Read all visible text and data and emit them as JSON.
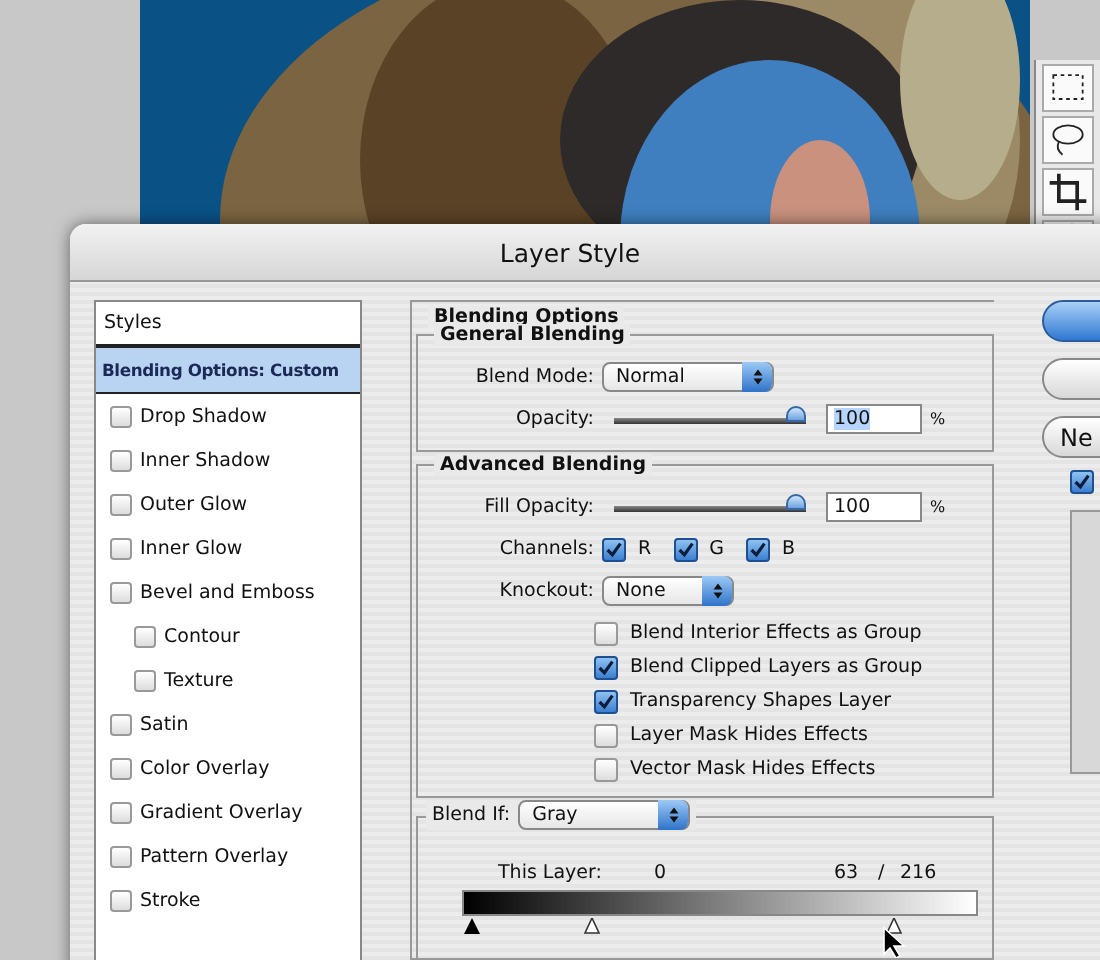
{
  "window": {
    "title": "Layer Style"
  },
  "styles_list": {
    "header": "Styles",
    "items": [
      {
        "label": "Blending Options: Custom",
        "kind": "heading",
        "selected": true
      },
      {
        "label": "Drop Shadow",
        "kind": "effect",
        "checked": false,
        "selected": false
      },
      {
        "label": "Inner Shadow",
        "kind": "effect",
        "checked": false,
        "selected": false
      },
      {
        "label": "Outer Glow",
        "kind": "effect",
        "checked": false,
        "selected": false
      },
      {
        "label": "Inner Glow",
        "kind": "effect",
        "checked": false,
        "selected": false
      },
      {
        "label": "Bevel and Emboss",
        "kind": "effect",
        "checked": false,
        "selected": false,
        "children": [
          {
            "label": "Contour",
            "kind": "effect",
            "checked": false,
            "selected": false
          },
          {
            "label": "Texture",
            "kind": "effect",
            "checked": false,
            "selected": false
          }
        ]
      },
      {
        "label": "Satin",
        "kind": "effect",
        "checked": false,
        "selected": false
      },
      {
        "label": "Color Overlay",
        "kind": "effect",
        "checked": false,
        "selected": false
      },
      {
        "label": "Gradient Overlay",
        "kind": "effect",
        "checked": false,
        "selected": false
      },
      {
        "label": "Pattern Overlay",
        "kind": "effect",
        "checked": false,
        "selected": false
      },
      {
        "label": "Stroke",
        "kind": "effect",
        "checked": false,
        "selected": false
      }
    ]
  },
  "blending_options": {
    "title": "Blending Options",
    "general": {
      "title": "General Blending",
      "blend_mode": {
        "label": "Blend Mode:",
        "value": "Normal"
      },
      "opacity": {
        "label": "Opacity:",
        "level": 1,
        "value": "100",
        "text_selected": true,
        "unit": "%"
      }
    },
    "advanced": {
      "title": "Advanced Blending",
      "fill_opacity": {
        "label": "Fill Opacity:",
        "level": 1,
        "value": "100",
        "text_selected": false,
        "unit": "%"
      },
      "channels": {
        "label": "Channels:",
        "items": [
          {
            "label": "R",
            "checked": true
          },
          {
            "label": "G",
            "checked": true
          },
          {
            "label": "B",
            "checked": true
          }
        ]
      },
      "knockout": {
        "label": "Knockout:",
        "value": "None"
      },
      "options": [
        {
          "label": "Blend Interior Effects as Group",
          "checked": false
        },
        {
          "label": "Blend Clipped Layers as Group",
          "checked": true
        },
        {
          "label": "Transparency Shapes Layer",
          "checked": true
        },
        {
          "label": "Layer Mask Hides Effects",
          "checked": false
        },
        {
          "label": "Vector Mask Hides Effects",
          "checked": false
        }
      ]
    },
    "blend_if": {
      "label": "Blend If:",
      "value": "Gray",
      "this_layer": {
        "label": "This Layer:",
        "low": "0",
        "high_a": "63",
        "separator": "/",
        "high_b": "216",
        "thumbs": [
          {
            "kind": "solid",
            "level": 0
          },
          {
            "kind": "half",
            "level": 0.24
          },
          {
            "kind": "half",
            "level": 0.85
          }
        ]
      }
    }
  },
  "buttons": [
    {
      "kind": "default"
    },
    {
      "kind": "plain"
    },
    {
      "kind": "plain",
      "label": "Ne"
    }
  ],
  "preview": {
    "checked": true
  }
}
